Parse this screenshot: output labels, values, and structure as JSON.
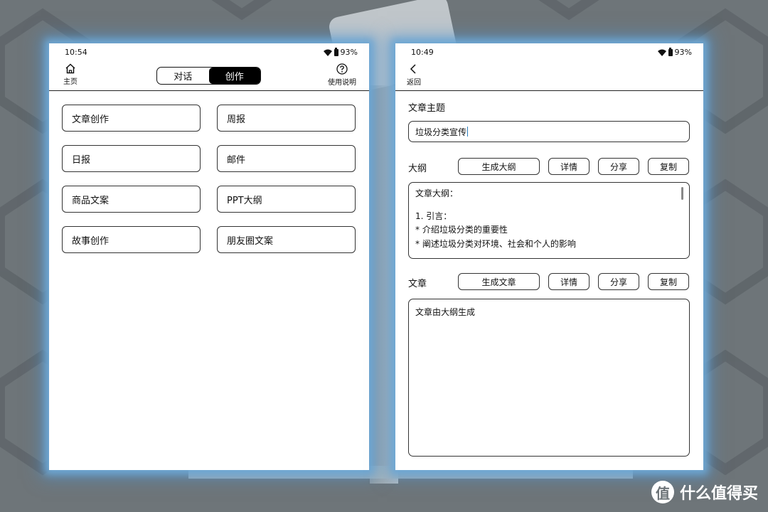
{
  "left": {
    "status": {
      "time": "10:54",
      "battery": "93%"
    },
    "home": {
      "label": "主页"
    },
    "help": {
      "label": "使用说明"
    },
    "tabs": [
      {
        "label": "对话",
        "active": false
      },
      {
        "label": "创作",
        "active": true
      }
    ],
    "items": [
      "文章创作",
      "周报",
      "日报",
      "邮件",
      "商品文案",
      "PPT大纲",
      "故事创作",
      "朋友圈文案"
    ]
  },
  "right": {
    "status": {
      "time": "10:49",
      "battery": "93%"
    },
    "back": {
      "label": "返回"
    },
    "topic": {
      "label": "文章主题",
      "value": "垃圾分类宣传"
    },
    "outline": {
      "label": "大纲",
      "generate": "生成大纲",
      "details": "详情",
      "share": "分享",
      "copy": "复制",
      "content": {
        "heading": "文章大纲：",
        "line1": "1. 引言：",
        "line2": "* 介绍垃圾分类的重要性",
        "line3": "* 阐述垃圾分类对环境、社会和个人的影响"
      }
    },
    "article": {
      "label": "文章",
      "generate": "生成文章",
      "details": "详情",
      "share": "分享",
      "copy": "复制",
      "content": "文章由大纲生成"
    }
  },
  "watermark": {
    "symbol": "值",
    "text": "什么值得买"
  }
}
